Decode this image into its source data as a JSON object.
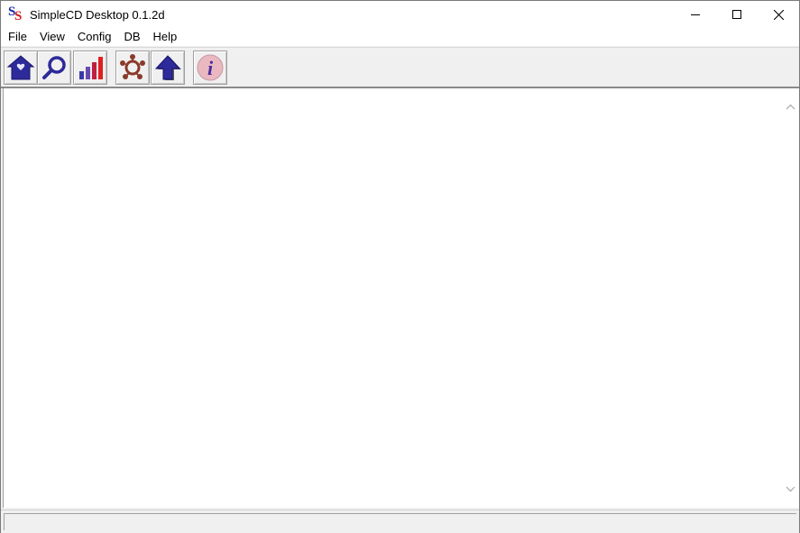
{
  "window": {
    "title": "SimpleCD Desktop 0.1.2d",
    "app_icon": "simplecd-ss-logo",
    "caption_buttons": [
      "minimize-icon",
      "maximize-icon",
      "close-icon"
    ]
  },
  "menu": {
    "items": [
      "File",
      "View",
      "Config",
      "DB",
      "Help"
    ]
  },
  "toolbar": {
    "buttons": [
      {
        "icon": "home-icon"
      },
      {
        "icon": "search-icon"
      },
      {
        "icon": "chart-icon"
      },
      {
        "icon": "network-icon"
      },
      {
        "icon": "upload-arrow-icon"
      },
      {
        "icon": "info-icon"
      }
    ]
  },
  "colors": {
    "icon_blue": "#2d2a9a",
    "icon_red": "#e02020",
    "icon_brown": "#8a3a2a",
    "info_bg": "#e9b8c0",
    "info_fg": "#4a2a9e"
  },
  "status": {
    "text": ""
  }
}
